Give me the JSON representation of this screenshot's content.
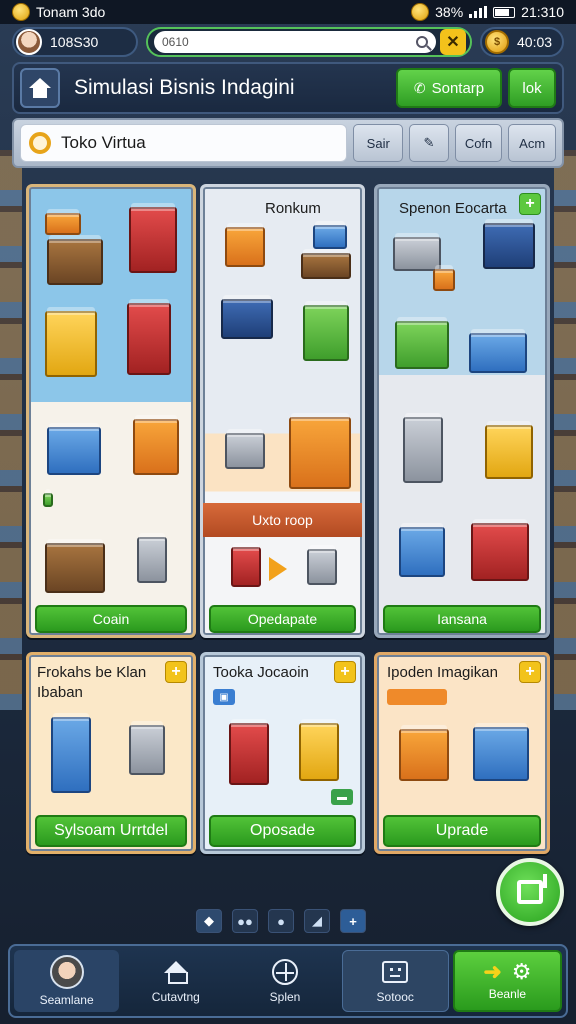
{
  "status_bar": {
    "left_text": "Tonam 3do",
    "battery_text": "38%",
    "time": "21:310"
  },
  "top_row": {
    "profile_value": "108S30",
    "search_value": "0610",
    "coins_value": "40:03"
  },
  "title_bar": {
    "title": "Simulasi Bisnis Indagini",
    "button_primary": "Sontarp",
    "button_secondary": "lok"
  },
  "filter_bar": {
    "shop_name": "Toko Virtua",
    "btn_1": "Sair",
    "btn_3": "Cofn",
    "btn_4": "Acm"
  },
  "cards": {
    "card1": {
      "button": "Coain"
    },
    "card2": {
      "title": "Ronkum",
      "banner": "Uxto roop",
      "button": "Opedapate"
    },
    "card3": {
      "title": "Spenon Eocarta",
      "button": "Iansana"
    },
    "card4": {
      "title": "Frokahs be Klan Ibaban",
      "button": "Sylsoam Urrtdel"
    },
    "card5": {
      "title": "Tooka Jocaoin",
      "button": "Oposade"
    },
    "card6": {
      "title": "Ipoden Imagikan",
      "button": "Uprade"
    }
  },
  "bottom_nav": {
    "item1": "Seamlane",
    "item2": "Cutavtng",
    "item3": "Splen",
    "item4": "Sotooc",
    "item5": "Beanle"
  },
  "colors": {
    "accent_green": "#3fb12c",
    "accent_yellow": "#f2c31b",
    "panel_dark": "#1a2940"
  },
  "icons": {
    "home": "home-icon",
    "search": "search-icon",
    "tools": "tools-icon",
    "coin": "coin-icon",
    "phone": "phone-icon",
    "plus": "plus-icon",
    "compass": "compass-icon",
    "gear": "gear-icon"
  }
}
